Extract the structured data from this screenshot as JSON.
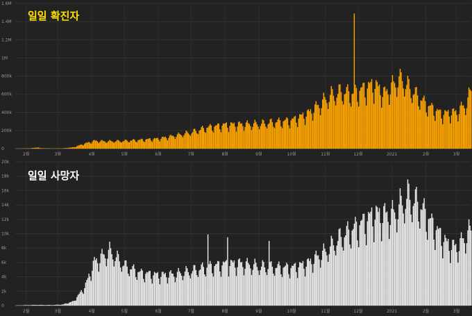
{
  "chart_data": [
    {
      "type": "bar",
      "title": "일일 확진자",
      "color": "#ffa500",
      "title_color": "#ffe100",
      "ylim": [
        0,
        1600000
      ],
      "y_ticks": [
        {
          "value": 0,
          "label": "0"
        },
        {
          "value": 200000,
          "label": "200k"
        },
        {
          "value": 400000,
          "label": "400k"
        },
        {
          "value": 600000,
          "label": "600k"
        },
        {
          "value": 800000,
          "label": "800k"
        },
        {
          "value": 1000000,
          "label": "1M"
        },
        {
          "value": 1200000,
          "label": "1.2M"
        },
        {
          "value": 1400000,
          "label": "1.4M"
        },
        {
          "value": 1600000,
          "label": "1.6M"
        }
      ],
      "x_ticks": [
        "2월",
        "3월",
        "4월",
        "5월",
        "6월",
        "7월",
        "8월",
        "9월",
        "10월",
        "11월",
        "12월",
        "2021",
        "2월",
        "3월"
      ],
      "start_date": "2020-01-22",
      "end_date": "2021-03-14",
      "anchors": [
        [
          "2020-01-22",
          500
        ],
        [
          "2020-02-05",
          3500
        ],
        [
          "2020-02-12",
          15000
        ],
        [
          "2020-02-13",
          5000
        ],
        [
          "2020-02-25",
          2000
        ],
        [
          "2020-03-05",
          3000
        ],
        [
          "2020-03-15",
          15000
        ],
        [
          "2020-03-25",
          55000
        ],
        [
          "2020-04-03",
          85000
        ],
        [
          "2020-04-15",
          80000
        ],
        [
          "2020-05-01",
          85000
        ],
        [
          "2020-05-15",
          95000
        ],
        [
          "2020-06-01",
          110000
        ],
        [
          "2020-06-15",
          140000
        ],
        [
          "2020-07-01",
          180000
        ],
        [
          "2020-07-15",
          230000
        ],
        [
          "2020-08-01",
          260000
        ],
        [
          "2020-08-15",
          265000
        ],
        [
          "2020-09-01",
          270000
        ],
        [
          "2020-09-15",
          290000
        ],
        [
          "2020-10-01",
          310000
        ],
        [
          "2020-10-15",
          380000
        ],
        [
          "2020-10-25",
          470000
        ],
        [
          "2020-11-05",
          580000
        ],
        [
          "2020-11-15",
          620000
        ],
        [
          "2020-11-26",
          600000
        ],
        [
          "2020-12-05",
          650000
        ],
        [
          "2020-12-15",
          700000
        ],
        [
          "2020-12-25",
          600000
        ],
        [
          "2021-01-08",
          780000
        ],
        [
          "2021-01-20",
          620000
        ],
        [
          "2021-02-01",
          480000
        ],
        [
          "2021-02-15",
          380000
        ],
        [
          "2021-03-01",
          400000
        ],
        [
          "2021-03-10",
          500000
        ],
        [
          "2021-03-14",
          640000
        ]
      ],
      "spikes": [
        [
          "2020-11-27",
          1490000
        ],
        [
          "2021-01-08",
          880000
        ]
      ]
    },
    {
      "type": "bar",
      "title": "일일 사망자",
      "color": "#ebebeb",
      "title_color": "#ffffff",
      "ylim": [
        0,
        20000
      ],
      "y_ticks": [
        {
          "value": 0,
          "label": "0"
        },
        {
          "value": 2000,
          "label": "2k"
        },
        {
          "value": 4000,
          "label": "4k"
        },
        {
          "value": 6000,
          "label": "6k"
        },
        {
          "value": 8000,
          "label": "8k"
        },
        {
          "value": 10000,
          "label": "10k"
        },
        {
          "value": 12000,
          "label": "12k"
        },
        {
          "value": 14000,
          "label": "14k"
        },
        {
          "value": 16000,
          "label": "16k"
        },
        {
          "value": 18000,
          "label": "18k"
        },
        {
          "value": 20000,
          "label": "20k"
        }
      ],
      "x_ticks": [
        "2월",
        "3월",
        "4월",
        "5월",
        "6월",
        "7월",
        "8월",
        "9월",
        "10월",
        "11월",
        "12월",
        "2021",
        "2월",
        "3월"
      ],
      "start_date": "2020-01-22",
      "end_date": "2021-03-14",
      "anchors": [
        [
          "2020-01-22",
          20
        ],
        [
          "2020-02-10",
          100
        ],
        [
          "2020-02-25",
          80
        ],
        [
          "2020-03-05",
          150
        ],
        [
          "2020-03-15",
          600
        ],
        [
          "2020-03-25",
          2500
        ],
        [
          "2020-04-03",
          6000
        ],
        [
          "2020-04-17",
          7500
        ],
        [
          "2020-05-01",
          5500
        ],
        [
          "2020-05-15",
          4500
        ],
        [
          "2020-06-01",
          4200
        ],
        [
          "2020-06-15",
          4300
        ],
        [
          "2020-07-01",
          4800
        ],
        [
          "2020-07-15",
          5300
        ],
        [
          "2020-08-01",
          5700
        ],
        [
          "2020-08-15",
          5800
        ],
        [
          "2020-09-01",
          5400
        ],
        [
          "2020-09-15",
          5300
        ],
        [
          "2020-10-01",
          5200
        ],
        [
          "2020-10-15",
          5800
        ],
        [
          "2020-11-01",
          7500
        ],
        [
          "2020-11-15",
          9500
        ],
        [
          "2020-12-01",
          11000
        ],
        [
          "2020-12-15",
          12500
        ],
        [
          "2021-01-01",
          12500
        ],
        [
          "2021-01-15",
          15000
        ],
        [
          "2021-01-25",
          14000
        ],
        [
          "2021-02-05",
          11500
        ],
        [
          "2021-02-20",
          8500
        ],
        [
          "2021-03-01",
          8000
        ],
        [
          "2021-03-14",
          10500
        ]
      ],
      "spikes": [
        [
          "2020-07-16",
          9900
        ],
        [
          "2020-08-03",
          9500
        ],
        [
          "2020-09-10",
          9000
        ]
      ]
    }
  ]
}
